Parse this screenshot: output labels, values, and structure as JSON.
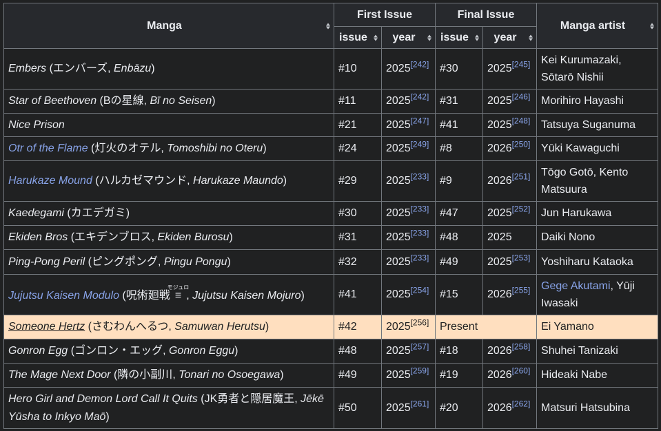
{
  "headers": {
    "manga": "Manga",
    "first_issue": "First Issue",
    "final_issue": "Final Issue",
    "artist": "Manga artist",
    "issue": "issue",
    "year": "year"
  },
  "rows": [
    {
      "title": "Embers",
      "paren_open": " (",
      "native": "エンバーズ",
      "sep": ", ",
      "romaji": "Enbāzu",
      "tail": "",
      "paren_close": ")",
      "first_issue": "#10",
      "first_year": "2025",
      "first_ref": "[242]",
      "final_issue": "#30",
      "final_year": "2025",
      "final_ref": "[245]",
      "artist": "Kei Kurumazaki, Sōtarō Nishii"
    },
    {
      "title": "Star of Beethoven",
      "paren_open": " (",
      "native": "Bの星線",
      "sep": ", ",
      "romaji": "Bī no Seisen",
      "tail": "",
      "paren_close": ")",
      "first_issue": "#11",
      "first_year": "2025",
      "first_ref": "[242]",
      "final_issue": "#31",
      "final_year": "2025",
      "final_ref": "[246]",
      "artist": "Morihiro Hayashi"
    },
    {
      "title": "Nice Prison",
      "paren_open": "",
      "native": "",
      "sep": "",
      "romaji": "",
      "tail": "",
      "paren_close": "",
      "first_issue": "#21",
      "first_year": "2025",
      "first_ref": "[247]",
      "final_issue": "#41",
      "final_year": "2025",
      "final_ref": "[248]",
      "artist": "Tatsuya Suganuma"
    },
    {
      "title": "Otr of the Flame",
      "paren_open": " (",
      "native": "灯火のオテル",
      "sep": ", ",
      "romaji": "Tomoshibi no Oteru",
      "tail": "",
      "paren_close": ")",
      "first_issue": "#24",
      "first_year": "2025",
      "first_ref": "[249]",
      "final_issue": "#8",
      "final_year": "2026",
      "final_ref": "[250]",
      "artist": "Yūki Kawaguchi"
    },
    {
      "title": "Harukaze Mound",
      "paren_open": " (",
      "native": "ハルカゼマウンド",
      "sep": ", ",
      "romaji": "Harukaze Maundo",
      "tail": "",
      "paren_close": ")",
      "first_issue": "#29",
      "first_year": "2025",
      "first_ref": "[233]",
      "final_issue": "#9",
      "final_year": "2026",
      "final_ref": "[251]",
      "artist": "Tōgo Gotō, Kento Matsuura"
    },
    {
      "title": "Kaedegami",
      "paren_open": " (",
      "native": "カエデガミ",
      "sep": "",
      "romaji": "",
      "tail": "",
      "paren_close": ")",
      "first_issue": "#30",
      "first_year": "2025",
      "first_ref": "[233]",
      "final_issue": "#47",
      "final_year": "2025",
      "final_ref": "[252]",
      "artist": "Jun Harukawa"
    },
    {
      "title": "Ekiden Bros",
      "paren_open": " (",
      "native": "エキデンブロス",
      "sep": ", ",
      "romaji": "Ekiden Burosu",
      "tail": "",
      "paren_close": ")",
      "first_issue": "#31",
      "first_year": "2025",
      "first_ref": "[233]",
      "final_issue": "#48",
      "final_year": "2025",
      "final_ref": "",
      "artist": "Daiki Nono"
    },
    {
      "title": "Ping-Pong Peril",
      "paren_open": " (",
      "native": "ピングポング",
      "sep": ", ",
      "romaji": "Pingu Pongu",
      "tail": "",
      "paren_close": ")",
      "first_issue": "#32",
      "first_year": "2025",
      "first_ref": "[233]",
      "final_issue": "#49",
      "final_year": "2025",
      "final_ref": "[253]",
      "artist": "Yoshiharu Kataoka"
    },
    {
      "title": "Jujutsu Kaisen Modulo",
      "paren_open": " (",
      "native": "呪術廻戦",
      "ruby_base": "≡",
      "ruby_text": "モジュロ",
      "sep": ", ",
      "romaji": "Jujutsu Kaisen Mojuro",
      "tail": "",
      "paren_close": ")",
      "first_issue": "#41",
      "first_year": "2025",
      "first_ref": "[254]",
      "final_issue": "#15",
      "final_year": "2026",
      "final_ref": "[255]",
      "artist_link": "Gege Akutami",
      "artist": ", Yūji Iwasaki"
    },
    {
      "title": "Someone Hertz",
      "paren_open": " (",
      "native": "さむわんへるつ",
      "sep": ", ",
      "romaji": "Samuwan Herutsu",
      "tail": "",
      "paren_close": ")",
      "first_issue": "#42",
      "first_year": "2025",
      "first_ref": "[256]",
      "final_issue": "Present",
      "artist": "Ei Yamano"
    },
    {
      "title": "Gonron Egg",
      "paren_open": " (",
      "native": "ゴンロン・エッグ",
      "sep": ", ",
      "romaji": "Gonron Eggu",
      "tail": "",
      "paren_close": ")",
      "first_issue": "#48",
      "first_year": "2025",
      "first_ref": "[257]",
      "final_issue": "#18",
      "final_year": "2026",
      "final_ref": "[258]",
      "artist": "Shuhei Tanizaki"
    },
    {
      "title": "The Mage Next Door",
      "paren_open": " (",
      "native": "隣の小副川",
      "sep": ", ",
      "romaji": "Tonari no Osoegawa",
      "tail": "",
      "paren_close": ")",
      "first_issue": "#49",
      "first_year": "2025",
      "first_ref": "[259]",
      "final_issue": "#19",
      "final_year": "2026",
      "final_ref": "[260]",
      "artist": "Hideaki Nabe"
    },
    {
      "title": "Hero Girl and Demon Lord Call It Quits",
      "paren_open": " (",
      "native": "JK勇者と隠居魔王",
      "sep": ", ",
      "romaji": "Jēkē Yūsha to Inkyo Maō",
      "tail": "",
      "paren_close": ")",
      "first_issue": "#50",
      "first_year": "2025",
      "first_ref": "[261]",
      "final_issue": "#20",
      "final_year": "2026",
      "final_ref": "[262]",
      "artist": "Matsuri Hatsubina"
    }
  ],
  "colors": {
    "background": "#202122",
    "header_bg": "#27292d",
    "border": "#72777d",
    "link": "#88a3e8",
    "highlight_row": "#ffdfbf"
  }
}
